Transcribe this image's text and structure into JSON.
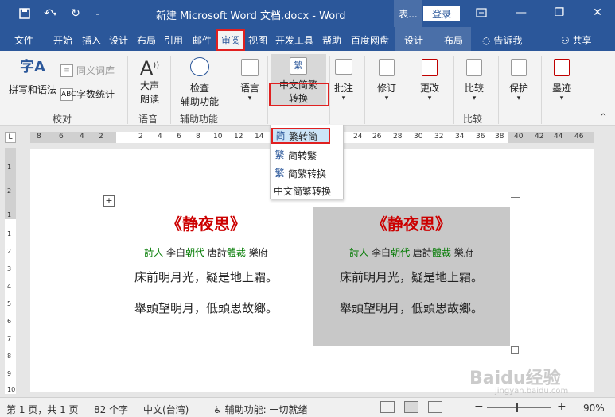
{
  "window": {
    "doc_title": "新建 Microsoft Word 文档.docx  -  Word",
    "context_tools": "表...",
    "login": "登录",
    "minimize": "—",
    "restore": "❐",
    "close": "✕"
  },
  "tabs": [
    "文件",
    "开始",
    "插入",
    "设计",
    "布局",
    "引用",
    "邮件",
    "审阅",
    "视图",
    "开发工具",
    "帮助",
    "百度网盘",
    "设计",
    "布局"
  ],
  "tell_me": "告诉我",
  "share": "共享",
  "ribbon": {
    "proofing": {
      "spell": "拼写和语法",
      "thesaurus": "同义词库",
      "word_count": "字数统计",
      "label": "校对"
    },
    "speech": {
      "read_aloud_1": "大声",
      "read_aloud_2": "朗读",
      "label": "语音"
    },
    "accessibility": {
      "check_1": "检查",
      "check_2": "辅助功能",
      "label": "辅助功能"
    },
    "language": {
      "btn": "语言"
    },
    "chinese_conv": {
      "btn_1": "中文简繁",
      "btn_2": "转换"
    },
    "comments": {
      "btn": "批注"
    },
    "tracking": {
      "btn": "修订"
    },
    "changes": {
      "btn": "更改"
    },
    "compare": {
      "btn": "比较",
      "label": "比较"
    },
    "protect": {
      "btn": "保护"
    },
    "ink": {
      "btn": "墨迹"
    }
  },
  "dropdown": {
    "items": [
      "繁转简",
      "简转繁",
      "简繁转换",
      "中文简繁转换"
    ]
  },
  "ruler": {
    "ticks": [
      "8",
      "6",
      "4",
      "2",
      "2",
      "4",
      "6",
      "8",
      "10",
      "12",
      "14",
      "24",
      "26",
      "28",
      "30",
      "32",
      "34",
      "36",
      "38",
      "40",
      "42",
      "44",
      "46"
    ],
    "v_ticks": [
      "1",
      "2",
      "1",
      "1",
      "2",
      "3",
      "4",
      "5",
      "6",
      "7",
      "8",
      "9",
      "10"
    ]
  },
  "poem_left": {
    "title": "《静夜思》",
    "meta_g1": "詩人",
    "meta_u1": "李白",
    "meta_g2": "朝代",
    "meta_u2": "唐詩",
    "meta_g3": "體裁",
    "meta_u3": "樂府",
    "line1": "床前明月光，疑是地上霜。",
    "line2": "舉頭望明月，低頭思故鄉。"
  },
  "poem_right": {
    "title": "《静夜思》",
    "meta_g1": "詩人",
    "meta_u1": "李白",
    "meta_g2": "朝代",
    "meta_u2": "唐詩",
    "meta_g3": "體裁",
    "meta_u3": "樂府",
    "line1": "床前明月光，疑是地上霜。",
    "line2": "舉頭望明月，低頭思故鄉。"
  },
  "status": {
    "page": "第 1 页，共 1 页",
    "words": "82 个字",
    "lang": "中文(台湾)",
    "access": "辅助功能: 一切就绪",
    "zoom_minus": "−",
    "zoom_plus": "+",
    "zoom": "90%"
  },
  "watermark": {
    "brand": "Baidu经验",
    "url": "jingyan.baidu.com"
  }
}
